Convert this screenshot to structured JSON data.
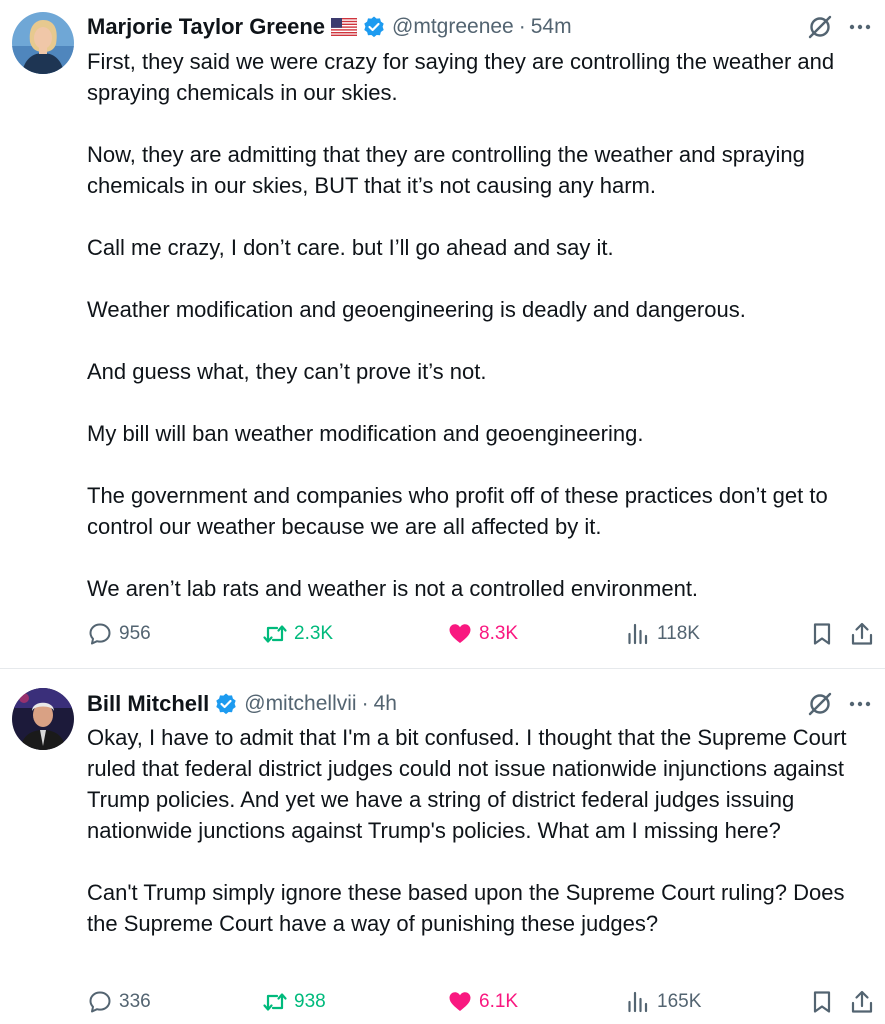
{
  "tweets": [
    {
      "author_name": "Marjorie Taylor Greene",
      "handle": "@mtgreenee",
      "time": "54m",
      "has_flag": true,
      "paragraphs": [
        "First, they said we were crazy for saying they are controlling the weather and spraying chemicals in our skies.",
        "Now, they are admitting that they are controlling the weather and spraying chemicals in our skies, BUT that it’s not causing any harm.",
        "Call me crazy, I don’t care. but I’ll go ahead and say it.",
        "Weather modification and geoengineering is deadly and dangerous.",
        "And guess what, they can’t prove it’s not.",
        "My bill will ban weather modification and geoengineering.",
        "The government and companies who profit off of these practices don’t get to control our weather because we are all affected by it.",
        "We aren’t lab rats and weather is not a controlled environment."
      ],
      "replies": "956",
      "reposts": "2.3K",
      "likes": "8.3K",
      "views": "118K"
    },
    {
      "author_name": "Bill Mitchell",
      "handle": "@mitchellvii",
      "time": "4h",
      "has_flag": false,
      "paragraphs": [
        "Okay, I have to admit that I'm a bit confused. I thought that the Supreme Court ruled that federal district judges could not issue nationwide injunctions against Trump policies. And yet we have a string of district federal judges issuing nationwide junctions against Trump's policies. What am I missing here?",
        "Can't Trump simply ignore these based upon the Supreme Court ruling? Does the Supreme Court have a way of punishing these judges?"
      ],
      "replies": "336",
      "reposts": "938",
      "likes": "6.1K",
      "views": "165K"
    }
  ],
  "separator": "·",
  "icons": {
    "verified": "verified-badge-icon",
    "flag": "us-flag-icon",
    "grok": "grok-icon",
    "more": "more-icon",
    "reply": "reply-icon",
    "repost": "repost-icon",
    "like": "heart-icon",
    "views": "views-icon",
    "bookmark": "bookmark-icon",
    "share": "share-icon"
  },
  "colors": {
    "text": "#0f1419",
    "muted": "#536471",
    "verified": "#1d9bf0",
    "repost": "#00ba7c",
    "like": "#f91880"
  }
}
